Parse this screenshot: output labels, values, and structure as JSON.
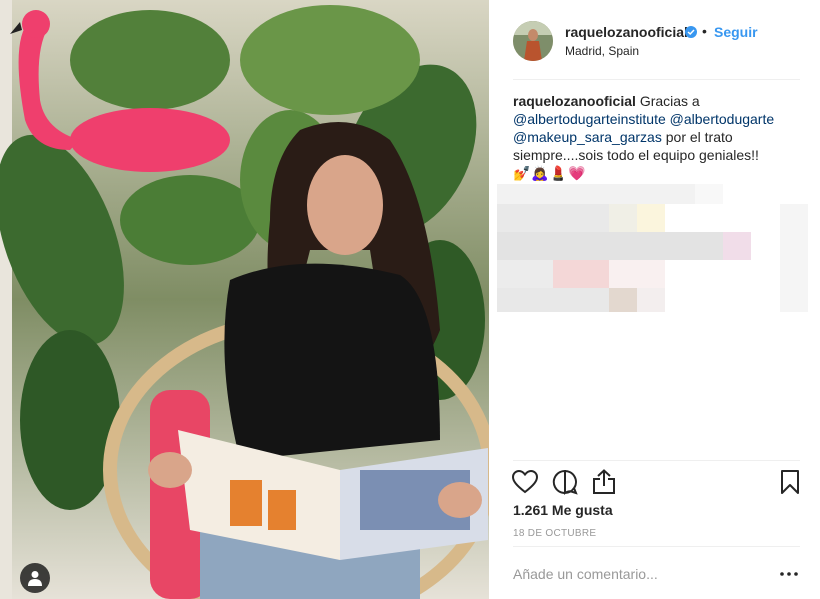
{
  "post": {
    "username": "raquelozanooficial",
    "follow_label": "Seguir",
    "separator": "•",
    "location": "Madrid, Spain"
  },
  "caption": {
    "author": "raquelozanooficial",
    "text_start": "Gracias a",
    "mention_1": "@albertodugarteinstitute",
    "mention_2": "@albertodugarte",
    "mention_3": "@makeup_sara_garzas",
    "text_mid": "por el trato siempre....sois todo el equipo geniales!!",
    "emojis": "💅🙇‍♀️💄💗"
  },
  "stats": {
    "likes": "1.261 Me gusta",
    "date": "18 DE OCTUBRE"
  },
  "comment": {
    "placeholder": "Añade un comentario..."
  },
  "icons": {
    "like": "heart-icon",
    "comment": "comment-bubble-icon",
    "share": "share-icon",
    "save": "bookmark-icon",
    "more": "more-dots-icon",
    "verified": "verified-badge-icon",
    "user_tag": "user-tag-icon"
  },
  "colors": {
    "accent": "#3897f0",
    "mention": "#003569",
    "muted": "#999999",
    "text": "#262626"
  }
}
